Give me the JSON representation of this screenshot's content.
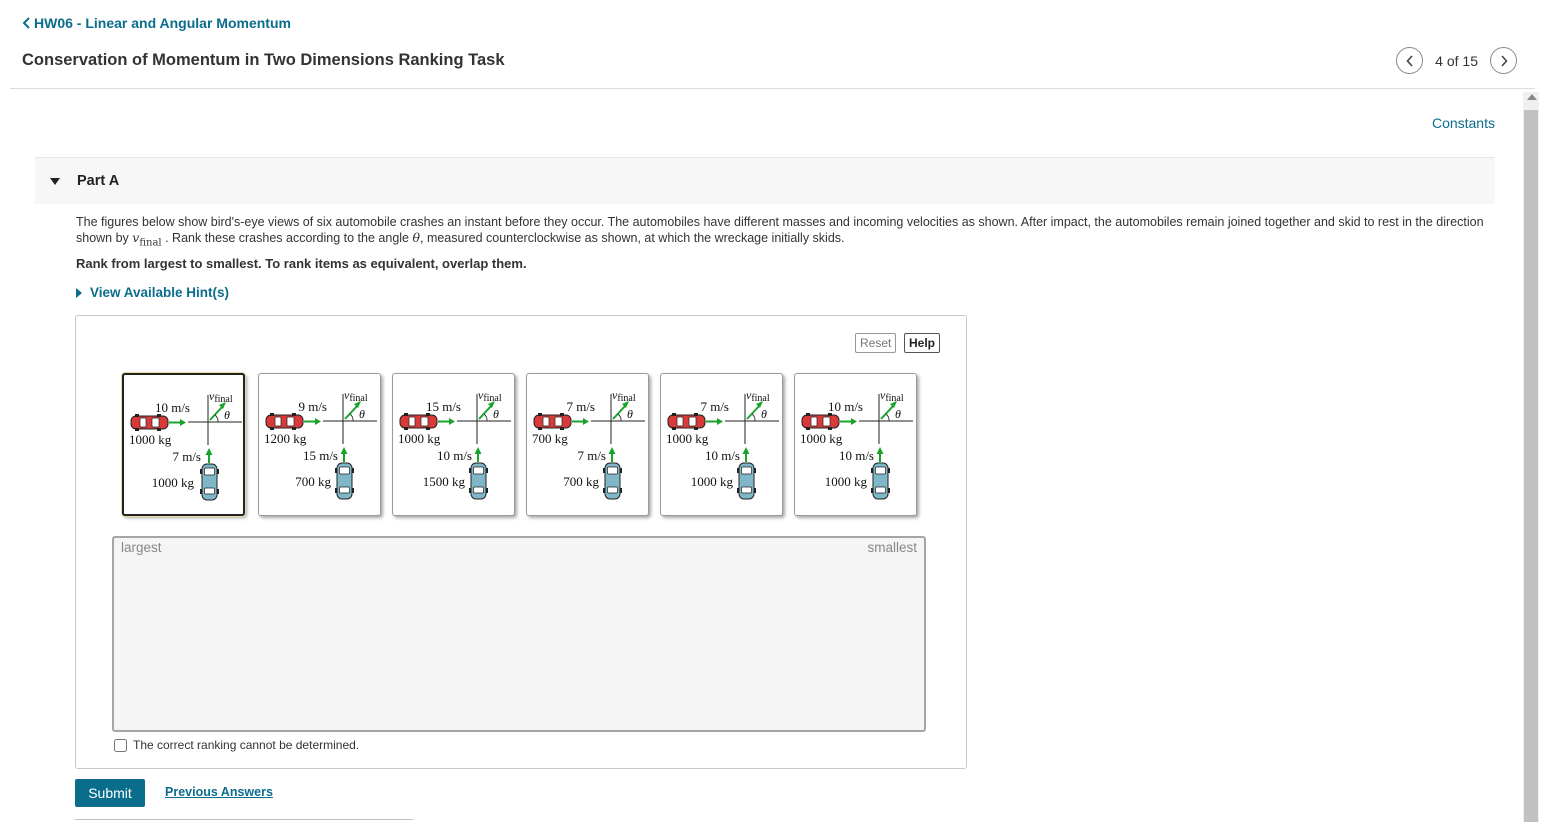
{
  "header": {
    "back_label": "HW06 - Linear and Angular Momentum",
    "title": "Conservation of Momentum in Two Dimensions Ranking Task",
    "pager_count": "4 of 15"
  },
  "constants_label": "Constants",
  "part": {
    "title": "Part A",
    "question_before": "The figures below show bird's-eye views of six automobile crashes an instant before they occur. The automobiles have different masses and incoming velocities as shown. After impact, the automobiles remain joined together and skid to rest in the direction shown by ",
    "question_var": "v",
    "question_var_sub": "final",
    "question_mid": " . Rank these crashes according to the angle ",
    "question_theta": "θ",
    "question_after": ", measured counterclockwise as shown, at which the wreckage initially skids.",
    "rank_instruction": "Rank from largest to smallest. To rank items as equivalent, overlap them.",
    "hint_label": "View Available Hint(s)"
  },
  "task": {
    "reset_label": "Reset",
    "help_label": "Help",
    "vfinal_label": "v",
    "vfinal_sub": "final",
    "theta_label": "θ",
    "cards": [
      {
        "red_speed": "10 m/s",
        "red_mass": "1000 kg",
        "blue_speed": "7 m/s",
        "blue_mass": "1000 kg"
      },
      {
        "red_speed": "9 m/s",
        "red_mass": "1200 kg",
        "blue_speed": "15 m/s",
        "blue_mass": "700 kg"
      },
      {
        "red_speed": "15 m/s",
        "red_mass": "1000 kg",
        "blue_speed": "10 m/s",
        "blue_mass": "1500 kg"
      },
      {
        "red_speed": "7 m/s",
        "red_mass": "700 kg",
        "blue_speed": "7 m/s",
        "blue_mass": "700 kg"
      },
      {
        "red_speed": "7 m/s",
        "red_mass": "1000 kg",
        "blue_speed": "10 m/s",
        "blue_mass": "1000 kg"
      },
      {
        "red_speed": "10 m/s",
        "red_mass": "1000 kg",
        "blue_speed": "10 m/s",
        "blue_mass": "1000 kg"
      }
    ],
    "largest_label": "largest",
    "smallest_label": "smallest",
    "cannot_determine_label": "The correct ranking cannot be determined."
  },
  "actions": {
    "submit_label": "Submit",
    "previous_answers_label": "Previous Answers"
  },
  "colors": {
    "link": "#0b6d8c",
    "red_car": "#d83a3a",
    "blue_car": "#7fb6c8",
    "arrow_green": "#1aa32b"
  }
}
